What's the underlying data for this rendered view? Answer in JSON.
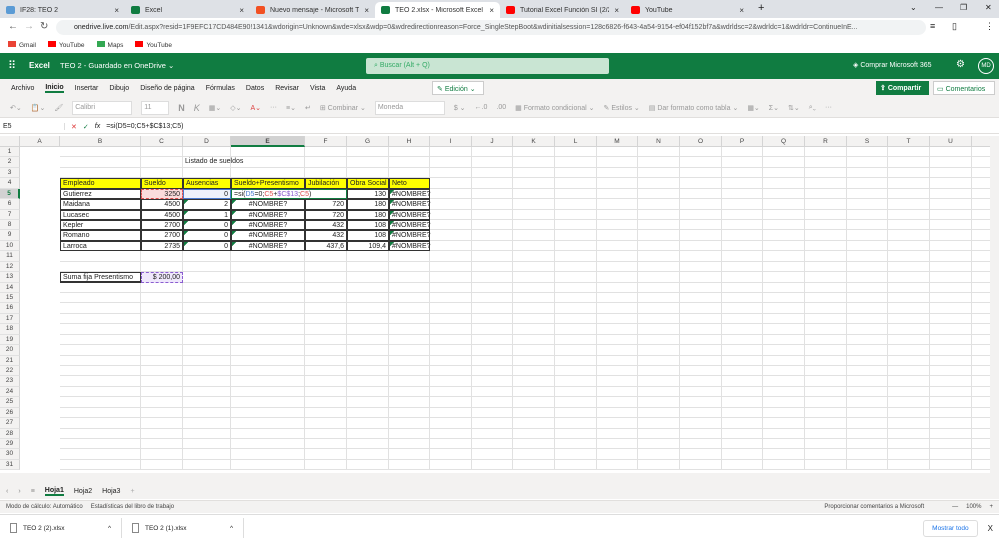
{
  "browser": {
    "tabs": [
      {
        "title": "IF28: TEO 2",
        "color": "#5b9bd5"
      },
      {
        "title": "Excel",
        "color": "#107c41"
      },
      {
        "title": "Nuevo mensaje - Microsoft Tech",
        "color": "#f25022"
      },
      {
        "title": "TEO 2.xlsx - Microsoft Excel Onl",
        "color": "#107c41",
        "active": true
      },
      {
        "title": "Tutorial Excel Función SI (2/2) - Y",
        "color": "#ff0000"
      },
      {
        "title": "YouTube",
        "color": "#ff0000"
      }
    ],
    "url_host": "onedrive.live.com",
    "url_rest": "/Edit.aspx?resid=1F9EFC17CD484E90!1341&wdorigin=Unknown&wde=xlsx&wdp=0&wdredirectionreason=Force_SingleStepBoot&wdinitialsession=128c6826-f643-4a54-9154-ef04f152bf7a&wdrldsc=2&wdrldc=1&wdrldr=ContinueInE...",
    "bookmarks": [
      "Gmail",
      "YouTube",
      "Maps",
      "YouTube"
    ]
  },
  "app": {
    "name": "Excel",
    "doc_title": "TEO 2",
    "saved_status": "- Guardado en OneDrive",
    "search_placeholder": "Buscar (Alt + Q)",
    "buy": "Comprar Microsoft 365",
    "avatar": "MD"
  },
  "ribbon": {
    "tabs": [
      "Archivo",
      "Inicio",
      "Insertar",
      "Dibujo",
      "Diseño de página",
      "Fórmulas",
      "Datos",
      "Revisar",
      "Vista",
      "Ayuda"
    ],
    "active_tab": "Inicio",
    "mode": "Edición",
    "share": "Compartir",
    "comments": "Comentarios",
    "font": "Calibri",
    "size": "11",
    "bold": "N",
    "italic": "K",
    "merge": "Combinar",
    "number_format": "Moneda",
    "currency": "$",
    "cond_format": "Formato condicional",
    "styles": "Estilos",
    "table_format": "Dar formato como tabla",
    "more": "···"
  },
  "formula_bar": {
    "name_box": "E5",
    "fx": "fx",
    "formula": "=si(D5=0;C5+$C$13;C5)"
  },
  "sheet": {
    "columns": [
      "A",
      "B",
      "C",
      "D",
      "E",
      "F",
      "G",
      "H",
      "I",
      "J",
      "K",
      "L",
      "M",
      "N",
      "O",
      "P",
      "Q",
      "R",
      "S",
      "T",
      "U",
      "V"
    ],
    "row_count": 31,
    "title": "Listado de sueldos",
    "headers": [
      "Empleado",
      "Sueldo",
      "Ausencias",
      "Sueldo+Presentismo",
      "Jubilación",
      "Obra Social",
      "Neto"
    ],
    "rows": [
      [
        "Gutierrez",
        "3250",
        "0",
        "=si(D5=0;C5+$C$13;C5)",
        "",
        "130",
        "#NOMBRE?"
      ],
      [
        "Maidana",
        "4500",
        "2",
        "#NOMBRE?",
        "720",
        "180",
        "#NOMBRE?"
      ],
      [
        "Lucasec",
        "4500",
        "1",
        "#NOMBRE?",
        "720",
        "180",
        "#NOMBRE?"
      ],
      [
        "Kepler",
        "2700",
        "0",
        "#NOMBRE?",
        "432",
        "108",
        "#NOMBRE?"
      ],
      [
        "Romano",
        "2700",
        "0",
        "#NOMBRE?",
        "432",
        "108",
        "#NOMBRE?"
      ],
      [
        "Larroca",
        "2735",
        "0",
        "#NOMBRE?",
        "437,6",
        "109,4",
        "#NOMBRE?"
      ]
    ],
    "fixed_label": "Suma fija Presentismo",
    "fixed_value": "$ 200,00",
    "header_fill": "#ffff00"
  },
  "sheet_tabs": {
    "tabs": [
      "Hoja1",
      "Hoja2",
      "Hoja3"
    ],
    "active": "Hoja1",
    "add": "+"
  },
  "status": {
    "calc": "Modo de cálculo: Automático",
    "stats": "Estadísticas del libro de trabajo",
    "feedback": "Proporcionar comentarios a Microsoft",
    "zoom": "100%"
  },
  "downloads": {
    "files": [
      "TEO 2 (2).xlsx",
      "TEO 2 (1).xlsx"
    ],
    "show_all": "Mostrar todo",
    "close": "X"
  }
}
